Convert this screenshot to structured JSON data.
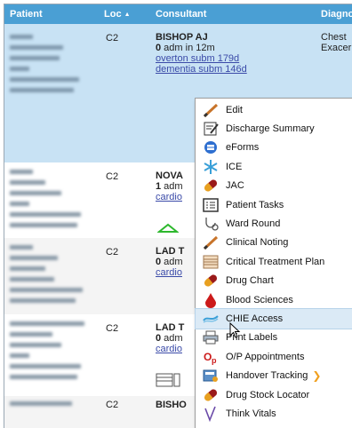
{
  "columns": {
    "patient": "Patient",
    "loc": "Loc",
    "consultant": "Consultant",
    "diagnosis": "Diagno"
  },
  "sort_indicator": "▲",
  "rows": [
    {
      "loc": "C2",
      "consultant": "BISHOP AJ",
      "adm_count": "0",
      "adm_text": " adm in 12m",
      "links": [
        "overton subm 179d",
        "dementia subm 146d"
      ],
      "diagnosis": [
        "Chest",
        "Exacer"
      ]
    },
    {
      "loc": "C2",
      "consultant": "NOVA",
      "adm_count": "1",
      "adm_text": " adm",
      "links": [
        "cardio"
      ]
    },
    {
      "loc": "C2",
      "consultant": "LAD T",
      "adm_count": "0",
      "adm_text": " adm",
      "links": [
        "cardio"
      ]
    },
    {
      "loc": "C2",
      "consultant": "LAD T",
      "adm_count": "0",
      "adm_text": " adm",
      "links": [
        "cardio"
      ]
    },
    {
      "loc": "C2",
      "consultant": "BISHO"
    }
  ],
  "menu": [
    {
      "label": "Edit",
      "icon": "pencil-icon"
    },
    {
      "label": "Discharge Summary",
      "icon": "document-edit-icon"
    },
    {
      "label": "eForms",
      "icon": "eforms-icon"
    },
    {
      "label": "ICE",
      "icon": "ice-snowflake-icon"
    },
    {
      "label": "JAC",
      "icon": "pill-icon"
    },
    {
      "label": "Patient Tasks",
      "icon": "tasks-list-icon"
    },
    {
      "label": "Ward Round",
      "icon": "stethoscope-icon"
    },
    {
      "label": "Clinical Noting",
      "icon": "pencil-icon"
    },
    {
      "label": "Critical Treatment Plan",
      "icon": "plan-sheet-icon"
    },
    {
      "label": "Drug Chart",
      "icon": "pill-icon"
    },
    {
      "label": "Blood Sciences",
      "icon": "blood-drop-icon"
    },
    {
      "label": "CHIE Access",
      "icon": "chie-icon"
    },
    {
      "label": "Print Labels",
      "icon": "printer-icon"
    },
    {
      "label": "O/P Appointments",
      "icon": "op-icon"
    },
    {
      "label": "Handover Tracking",
      "icon": "handover-icon"
    },
    {
      "label": "Drug Stock Locator",
      "icon": "pill-icon"
    },
    {
      "label": "Think Vitals",
      "icon": "vitals-icon"
    }
  ],
  "menu_highlighted": "CHIE Access",
  "colors": {
    "header": "#4a9fd4",
    "selected_row": "#c8e2f4",
    "link": "#3a4aa8",
    "menu_highlight": "#dbeaf6"
  }
}
